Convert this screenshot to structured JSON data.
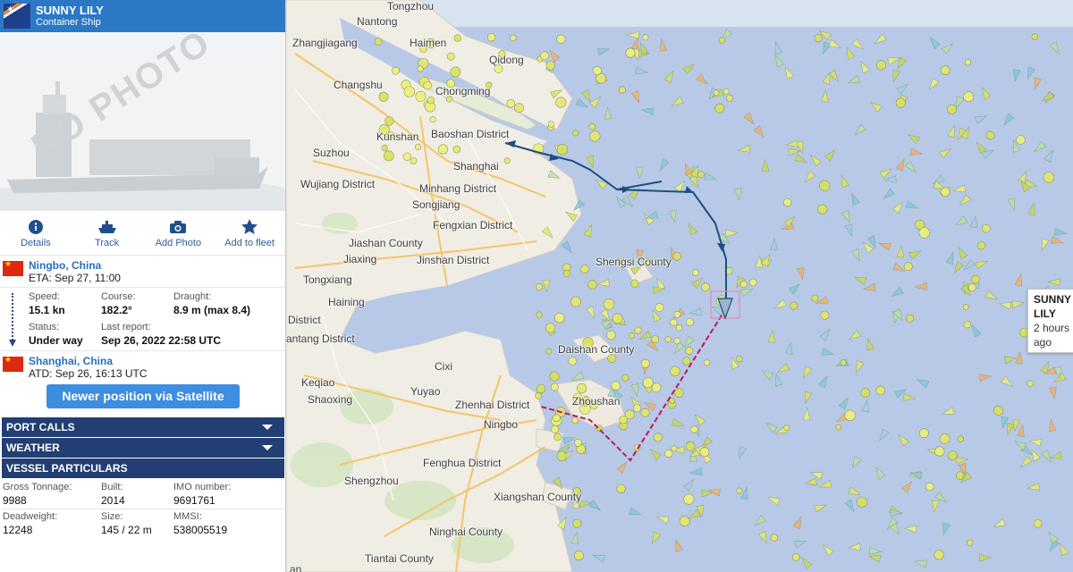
{
  "vessel": {
    "name": "SUNNY LILY",
    "type": "Container Ship",
    "photo_placeholder": "NO PHOTO"
  },
  "actions": [
    {
      "label": "Details",
      "icon": "info-icon"
    },
    {
      "label": "Track",
      "icon": "ship-icon"
    },
    {
      "label": "Add Photo",
      "icon": "camera-icon"
    },
    {
      "label": "Add to fleet",
      "icon": "star-icon"
    }
  ],
  "destination": {
    "port": "Ningbo, China",
    "eta": "ETA: Sep 27, 11:00"
  },
  "origin": {
    "port": "Shanghai, China",
    "atd": "ATD: Sep 26, 16:13 UTC"
  },
  "voyage": {
    "speed_label": "Speed:",
    "speed": "15.1 kn",
    "course_label": "Course:",
    "course": "182.2°",
    "draught_label": "Draught:",
    "draught": "8.9 m (max 8.4)",
    "status_label": "Status:",
    "status": "Under way",
    "last_report_label": "Last report:",
    "last_report": "Sep 26, 2022 22:58 UTC"
  },
  "satellite_button": "Newer position via Satellite",
  "sections": {
    "port_calls": "PORT CALLS",
    "weather": "WEATHER",
    "particulars": "VESSEL PARTICULARS"
  },
  "particulars": {
    "gross_tonnage_label": "Gross Tonnage:",
    "gross_tonnage": "9988",
    "built_label": "Built:",
    "built": "2014",
    "imo_label": "IMO number:",
    "imo": "9691761",
    "deadweight_label": "Deadweight:",
    "deadweight": "12248",
    "size_label": "Size:",
    "size": "145 / 22 m",
    "mmsi_label": "MMSI:",
    "mmsi": "538005519"
  },
  "tooltip": {
    "name": "SUNNY LILY",
    "time": "2 hours ago"
  },
  "map_labels": [
    "Tongzhou",
    "Nantong",
    "Zhangjiagang",
    "Haimen",
    "Qidong",
    "Changshu",
    "Chongming",
    "Kunshan",
    "Baoshan District",
    "Suzhou",
    "Shanghai",
    "Wujiang District",
    "Minhang District",
    "Songjiang",
    "Fengxian District",
    "Jiashan County",
    "Jiaxing",
    "Jinshan District",
    "Shengsi County",
    "Tongxiang",
    "Haining",
    "District",
    "antang District",
    "Daishan County",
    "Cixi",
    "Keqiao",
    "Yuyao",
    "Shaoxing",
    "Zhoushan",
    "Zhenhai District",
    "Ningbo",
    "Fenghua District",
    "Shengzhou",
    "Xiangshan County",
    "Ninghai County",
    "Tiantai County",
    "an"
  ],
  "colors": {
    "header": "#2b78c5",
    "section": "#223e73",
    "button": "#3d8de0",
    "track": "#1c4f7f",
    "route": "#c0185f"
  }
}
